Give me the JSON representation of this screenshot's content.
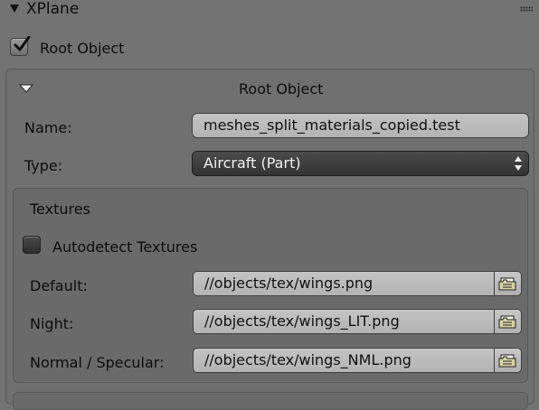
{
  "panel": {
    "title": "XPlane"
  },
  "root_toggle": {
    "label": "Root Object",
    "checked": true
  },
  "root_box": {
    "title": "Root Object",
    "name_label": "Name:",
    "name_value": "meshes_split_materials_copied.test",
    "type_label": "Type:",
    "type_value": "Aircraft (Part)"
  },
  "textures": {
    "title": "Textures",
    "autodetect_label": "Autodetect Textures",
    "autodetect_checked": false,
    "rows": [
      {
        "label": "Default:",
        "value": "//objects/tex/wings.png"
      },
      {
        "label": "Night:",
        "value": "//objects/tex/wings_LIT.png"
      },
      {
        "label": "Normal / Specular:",
        "value": "//objects/tex/wings_NML.png"
      }
    ]
  },
  "icons": {
    "panel_collapse": "triangle-down-icon",
    "box_collapse": "triangle-down-icon",
    "drag": "drag-grip-icon",
    "file_browse": "folder-open-icon",
    "select_arrows": "up-down-arrows-icon",
    "check": "checkmark-icon"
  }
}
